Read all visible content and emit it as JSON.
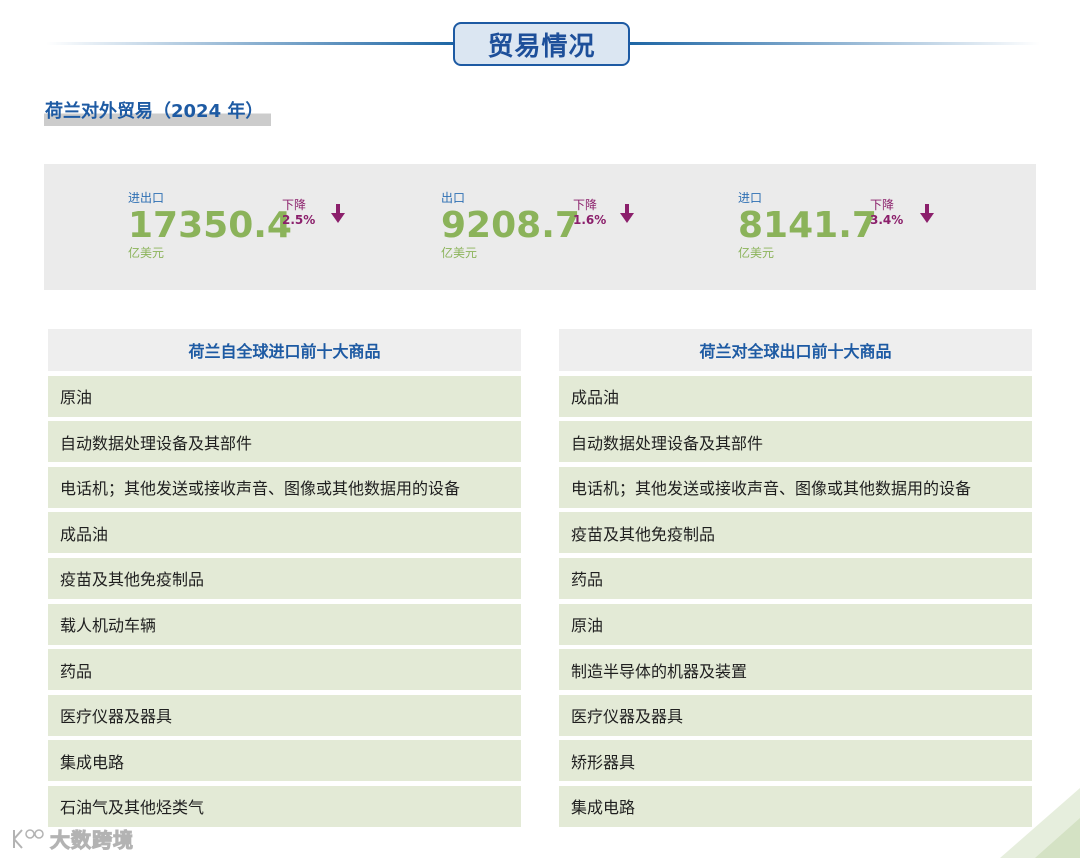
{
  "header": {
    "title": "贸易情况"
  },
  "section": {
    "title": "荷兰对外贸易（2024 年）"
  },
  "stats": [
    {
      "label": "进出口",
      "value": "17350.4",
      "unit": "亿美元",
      "direction": "下降",
      "change": "2.5%"
    },
    {
      "label": "出口",
      "value": "9208.7",
      "unit": "亿美元",
      "direction": "下降",
      "change": "1.6%"
    },
    {
      "label": "进口",
      "value": "8141.7",
      "unit": "亿美元",
      "direction": "下降",
      "change": "3.4%"
    }
  ],
  "imports": {
    "title": "荷兰自全球进口前十大商品",
    "items": [
      "原油",
      "自动数据处理设备及其部件",
      "电话机；其他发送或接收声音、图像或其他数据用的设备",
      "成品油",
      "疫苗及其他免疫制品",
      "载人机动车辆",
      "药品",
      "医疗仪器及器具",
      "集成电路",
      "石油气及其他烃类气"
    ]
  },
  "exports": {
    "title": "荷兰对全球出口前十大商品",
    "items": [
      "成品油",
      "自动数据处理设备及其部件",
      "电话机；其他发送或接收声音、图像或其他数据用的设备",
      "疫苗及其他免疫制品",
      "药品",
      "原油",
      "制造半导体的机器及装置",
      "医疗仪器及器具",
      "矫形器具",
      "集成电路"
    ]
  },
  "watermark": {
    "text": "大数跨境"
  },
  "colors": {
    "primary_blue": "#1d5aa3",
    "value_green": "#8bb35a",
    "decline_purple": "#8b1f6b",
    "row_bg": "#e3ead6"
  }
}
